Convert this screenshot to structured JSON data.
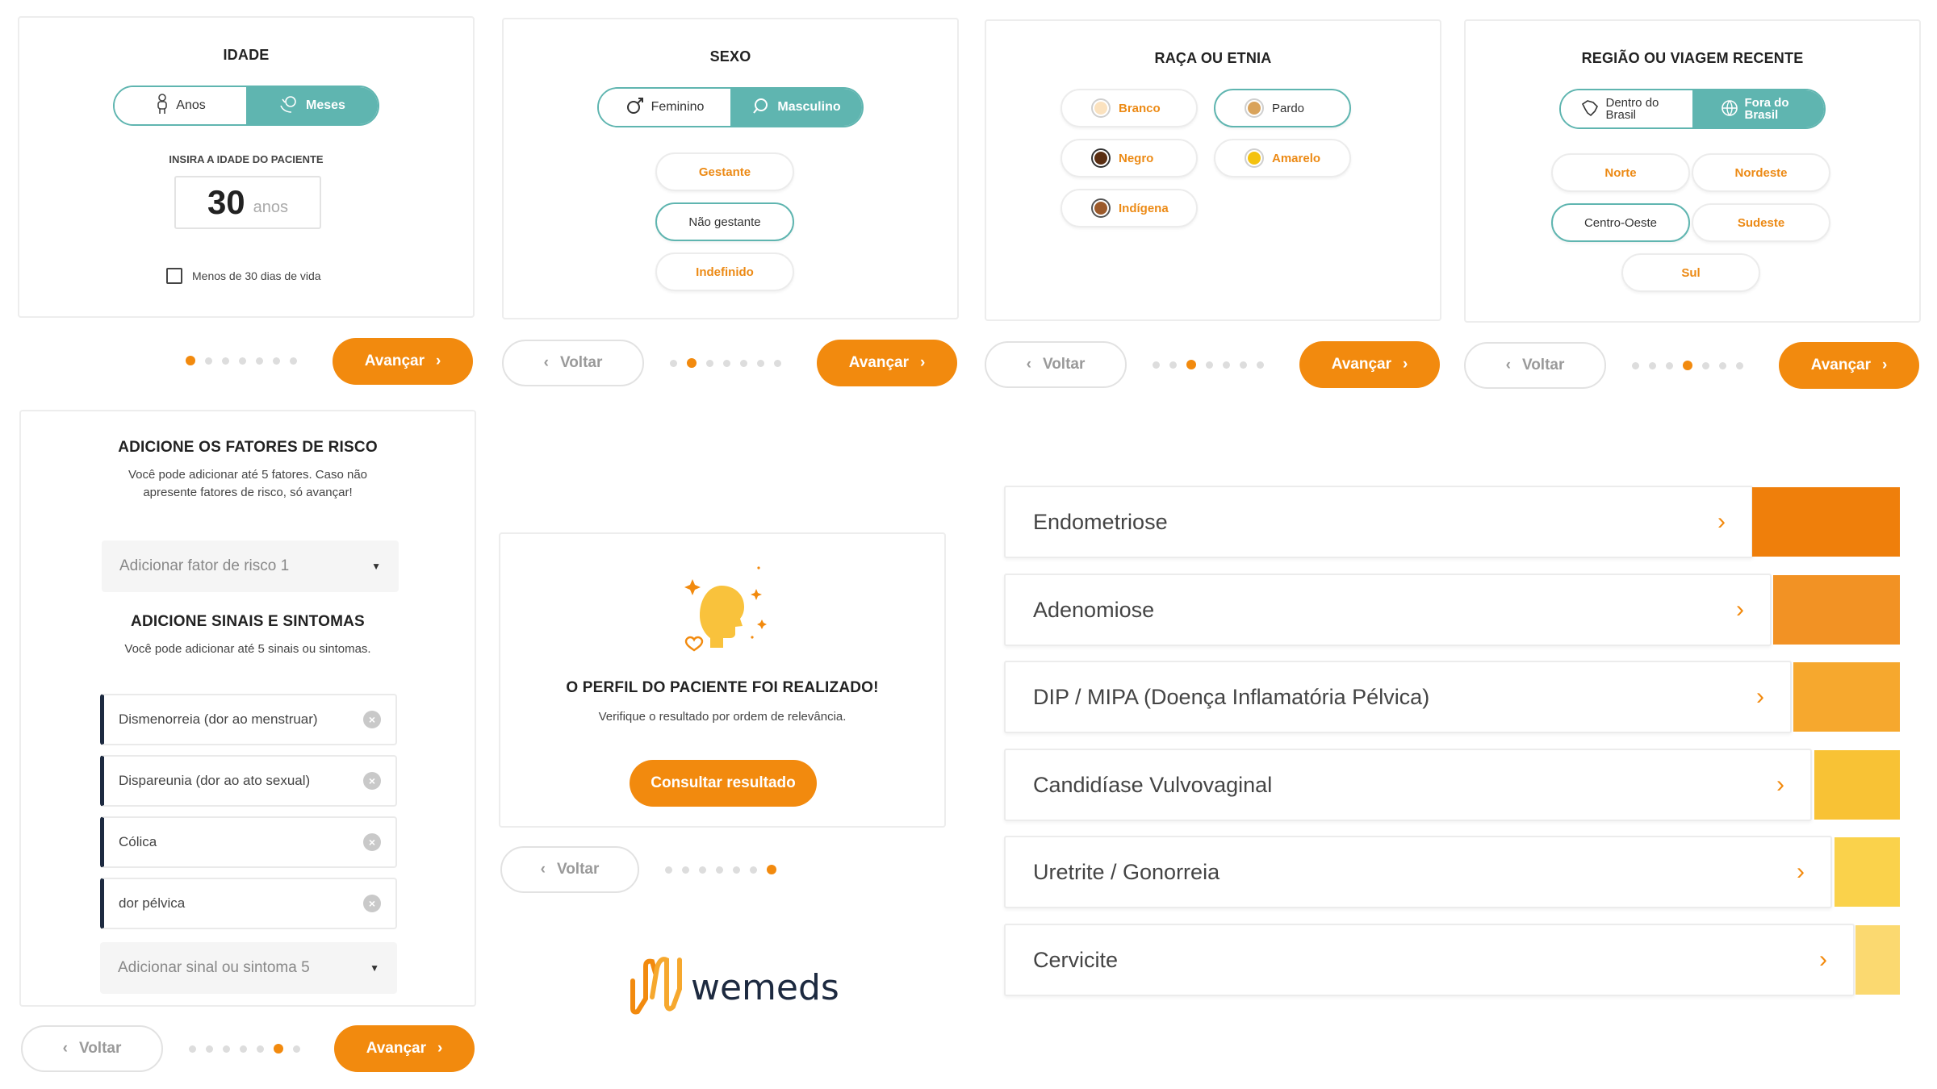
{
  "colors": {
    "orange": "#f28a0e",
    "teal": "#5fb5b0",
    "navy": "#1d2a40",
    "bar_colors": [
      "#ef7f0b",
      "#f29224",
      "#f6a82e",
      "#f8c235",
      "#fad24b",
      "#fbd970"
    ]
  },
  "common": {
    "next_label": "Avançar",
    "back_label": "Voltar",
    "chevron_right": "›",
    "chevron_left": "‹"
  },
  "age": {
    "title": "IDADE",
    "unit_years": "Anos",
    "unit_months": "Meses",
    "input_label": "INSIRA A IDADE DO PACIENTE",
    "value": "30",
    "value_unit": "anos",
    "checkbox_label": "Menos de 30 dias de vida",
    "step": 1
  },
  "sex": {
    "title": "SEXO",
    "female": "Feminino",
    "male": "Masculino",
    "options": [
      "Gestante",
      "Não gestante",
      "Indefinido"
    ],
    "selected": "Não gestante",
    "step": 2
  },
  "race": {
    "title": "RAÇA OU ETNIA",
    "options": [
      {
        "label": "Branco",
        "color": "#fbe2bf"
      },
      {
        "label": "Pardo",
        "color": "#d9a35b"
      },
      {
        "label": "Negro",
        "color": "#5a2e12"
      },
      {
        "label": "Amarelo",
        "color": "#f4c20f"
      },
      {
        "label": "Indígena",
        "color": "#9c5a2b"
      }
    ],
    "selected": "Pardo",
    "step": 3
  },
  "region": {
    "title": "REGIÃO OU VIAGEM RECENTE",
    "inside": "Dentro do Brasil",
    "outside": "Fora do Brasil",
    "options": [
      "Norte",
      "Nordeste",
      "Centro-Oeste",
      "Sudeste",
      "Sul"
    ],
    "selected": "Centro-Oeste",
    "step": 4
  },
  "risk": {
    "title": "ADICIONE OS FATORES DE RISCO",
    "subtitle": "Você pode adicionar até 5 fatores. Caso não apresente fatores de risco, só avançar!",
    "placeholder": "Adicionar fator de risco 1",
    "symptoms_title": "ADICIONE SINAIS E SINTOMAS",
    "symptoms_subtitle": "Você pode adicionar até 5 sinais ou sintomas.",
    "symptoms": [
      "Dismenorreia (dor ao menstruar)",
      "Dispareunia (dor ao ato sexual)",
      "Cólica",
      "dor pélvica"
    ],
    "symptom_placeholder": "Adicionar sinal ou sintoma 5",
    "step": 6
  },
  "profile": {
    "title": "O PERFIL DO PACIENTE FOI REALIZADO!",
    "subtitle": "Verifique o resultado por ordem de relevância.",
    "button": "Consultar resultado",
    "step": 7
  },
  "brand": {
    "name": "wemeds"
  },
  "results": [
    {
      "label": "Endometriose",
      "relevance": 6
    },
    {
      "label": "Adenomiose",
      "relevance": 5
    },
    {
      "label": "DIP / MIPA (Doença Inflamatória Pélvica)",
      "relevance": 4
    },
    {
      "label": "Candidíase Vulvovaginal",
      "relevance": 3
    },
    {
      "label": "Uretrite / Gonorreia",
      "relevance": 2
    },
    {
      "label": "Cervicite",
      "relevance": 1
    }
  ],
  "pagination": {
    "total": 7
  }
}
